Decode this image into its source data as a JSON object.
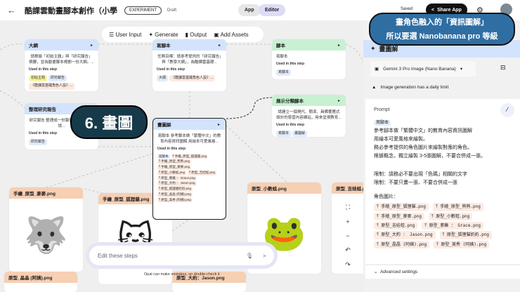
{
  "header": {
    "title": "酷課雲動畫腳本創作（小學",
    "badge": "EXPERIMENT",
    "status": "Draft",
    "app": "App",
    "editor": "Editor",
    "saved": "Saved",
    "share": "Share App"
  },
  "toolbar": {
    "user_input": "User Input",
    "generate": "Generate",
    "output": "Output",
    "add_assets": "Add Assets"
  },
  "nodes": {
    "outline": {
      "title": "大綱",
      "body": "請根據「初始主題」與「研究報告」摘要，並為動畫腳本規劃一份大綱。...",
      "used": "Used in this step",
      "chips": [
        "初始主題",
        "研究報告",
        "《酷課雲基礎角色人設》..."
      ]
    },
    "script_write": {
      "title": "寫腳本",
      "body": "任務目標：請參考提供的「研究報告」與「教學大綱」，為酷課雲基礎...",
      "used": "Used in this step",
      "chips": [
        "大綱",
        "《酷課雲基礎角色人設》..."
      ]
    },
    "script": {
      "title": "腳本",
      "body": "寫腳本",
      "used": "Used in this step",
      "chips": [
        "寫腳本"
      ]
    },
    "research": {
      "title": "整理研究報告",
      "body": "研究報告 整理成一份報告 ... 習目標：請...",
      "used": "Used in this step",
      "chips": [
        "研究報告"
      ]
    },
    "draw": {
      "title": "畫圖解",
      "body": "寫腳本 參考腳本做「繁體中文」的教育內容資訊圖解 用繪本可愛風格...",
      "used": "Used in this step",
      "chips": [
        "寫腳本",
        "手繪_原型_狐狸貓.png",
        "手繪_原型_熊熊.png",
        "手繪_原型_麥麥.png",
        "原型_小數蛙.png",
        "原型_吉娃蛙.png",
        "原型_蔥雞 ： Grace.png",
        "原型_大約 ： Jason.png",
        "原型_狐狸貓奶奶.png",
        "原型_晶晶 (阿姨).png",
        "原型_美秀 (阿姨).png"
      ]
    },
    "display": {
      "title": "展示分類腳本",
      "body": "請建立一個現代、簡潔、具備響應式設計的學習內容網站，用來呈現教育...",
      "used": "Used in this step",
      "chips": [
        "寫腳本",
        "畫圖解"
      ]
    },
    "assets": [
      "手繪_原型_麥麥.png",
      "手繪_原型_狐狸貓.png",
      "原型_小數蛙.png",
      "原型_吉娃蛙.png",
      "原型_晶晶 (阿姨).png",
      "原型_大約：Jason.png"
    ]
  },
  "callout_step": "6. 畫圖",
  "callout_note": {
    "line1": "畫角色融入的「資訊圖解」",
    "line2": "所以要選 Nanobanana pro 等級"
  },
  "edit": {
    "placeholder": "Edit these steps",
    "disclaimer": "Opal can make mistakes, so double-check it"
  },
  "panel": {
    "title": "畫圖解",
    "model": "Gemini 3 Pro Image (Nano Banana)",
    "limit": "Image generation has a daily limit",
    "prompt_label": "Prompt",
    "ref_chip": "寫腳本",
    "lines": [
      "參考腳本做「繁體中文」的教育內容資訊圖解",
      "用繪本可愛風格來繪製。",
      "務必參考提供的角色圖片來繪製對應的角色。",
      "根據概念，獨立繪製 3-5張圖解，不要合併成一張。"
    ],
    "limits": [
      "限制：請務必不要出現「色碼」相關的文字",
      "限制：不要只畫一張、不要合併成一張"
    ],
    "char_label": "角色圖片：",
    "chars": [
      "手繪_原型_狐狸貓.png",
      "手繪_原型_熊熊.png",
      "手繪_原型_麥麥.png",
      "原型_小數蛙.png",
      "原型_吉娃蛙.png",
      "原型_蔥雞 ： Grace.png",
      "原型_大約 ： Jason.png",
      "原型_狐狸貓奶奶.png",
      "原型_晶晶 (阿姨).png",
      "原型_美秀 (阿姨).png"
    ],
    "advanced": "Advanced settings"
  }
}
